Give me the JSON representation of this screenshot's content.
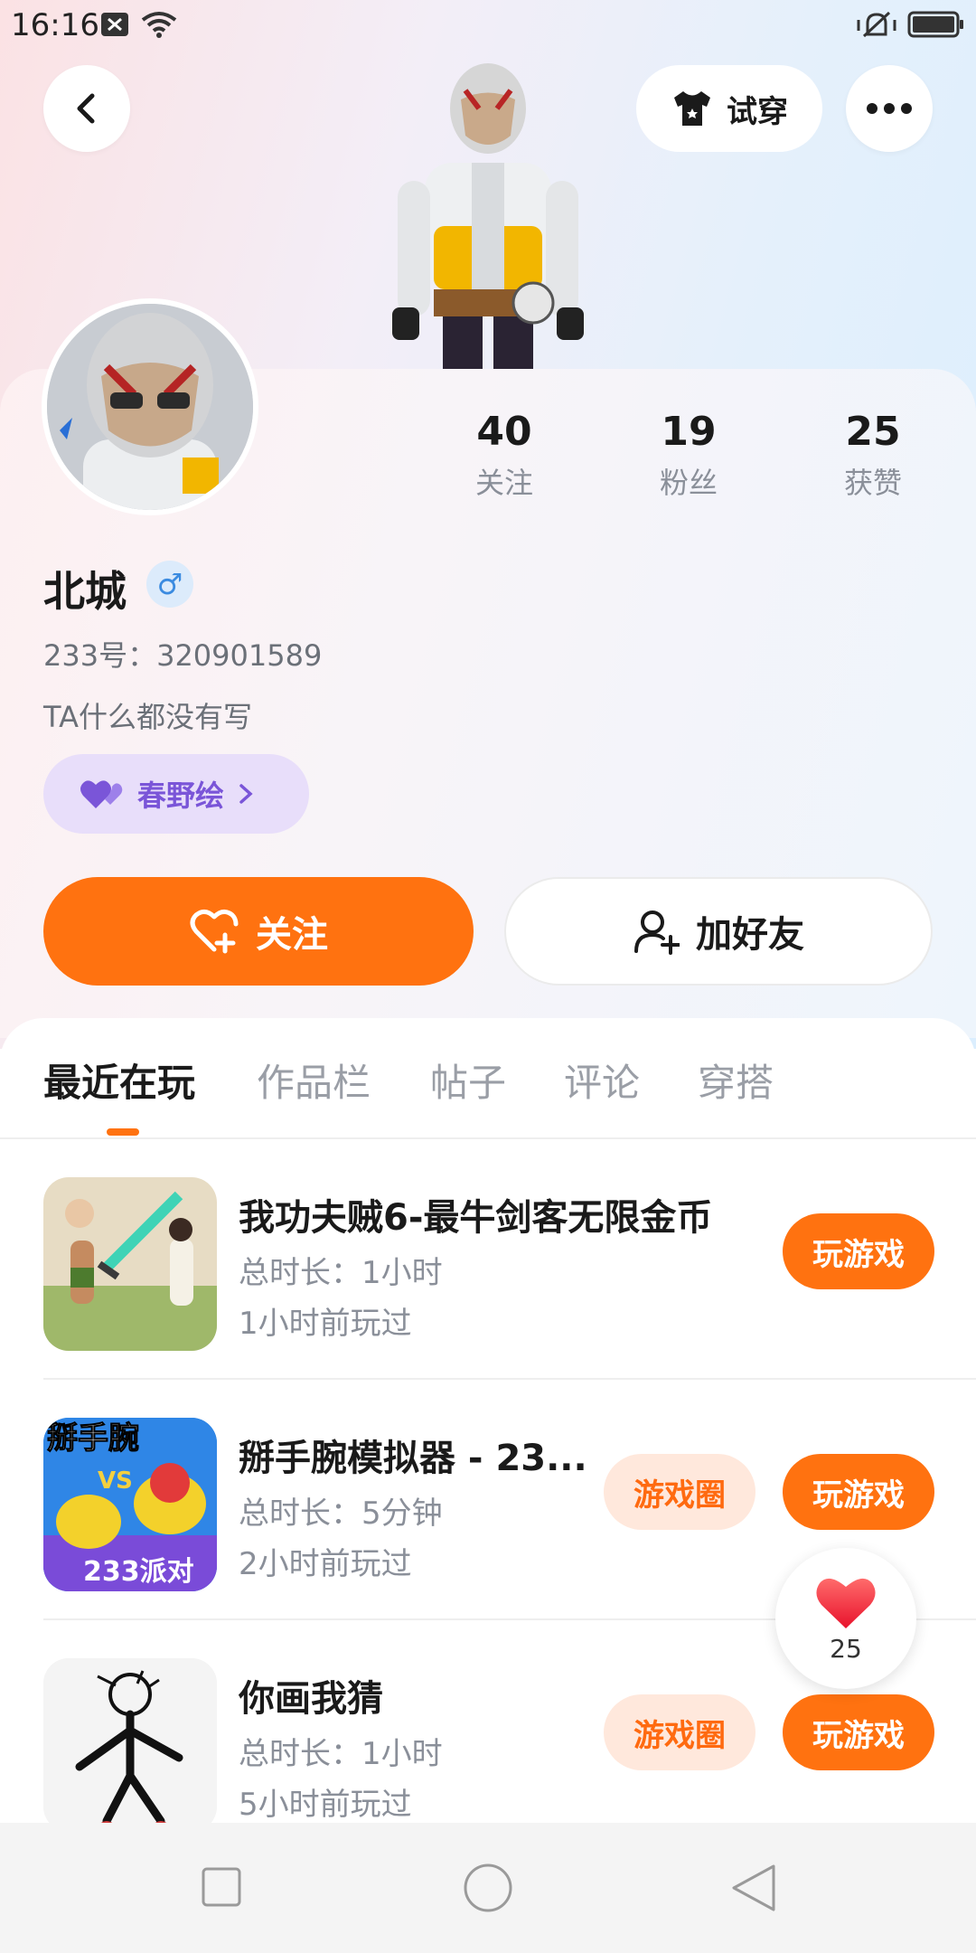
{
  "status_bar": {
    "time": "16:16"
  },
  "header": {
    "try_on_label": "试穿"
  },
  "profile": {
    "stats": [
      {
        "value": "40",
        "label": "关注"
      },
      {
        "value": "19",
        "label": "粉丝"
      },
      {
        "value": "25",
        "label": "获赞"
      }
    ],
    "name": "北城",
    "gender_symbol": "♂",
    "uid": "233号：320901589",
    "bio": "TA什么都没有写",
    "tag": "春野绘"
  },
  "actions": {
    "follow": "关注",
    "add_friend": "加好友"
  },
  "tabs": [
    "最近在玩",
    "作品栏",
    "帖子",
    "评论",
    "穿搭"
  ],
  "games": [
    {
      "title": "我功夫贼6-最牛剑客无限金币",
      "duration": "总时长：1小时",
      "last_played": "1小时前玩过",
      "play": "玩游戏",
      "circle": ""
    },
    {
      "title": "掰手腕模拟器 - 23...",
      "duration": "总时长：5分钟",
      "last_played": "2小时前玩过",
      "play": "玩游戏",
      "circle": "游戏圈",
      "thumb_text_top": "掰手腕",
      "thumb_text_vs": "VS",
      "thumb_text_bottom": "233派对"
    },
    {
      "title": "你画我猜",
      "duration": "总时长：1小时",
      "last_played": "5小时前玩过",
      "play": "玩游戏",
      "circle": "游戏圈"
    }
  ],
  "floating_like": {
    "count": "25"
  },
  "colors": {
    "accent": "#ff7210",
    "tag_purple": "#7a55d8"
  }
}
